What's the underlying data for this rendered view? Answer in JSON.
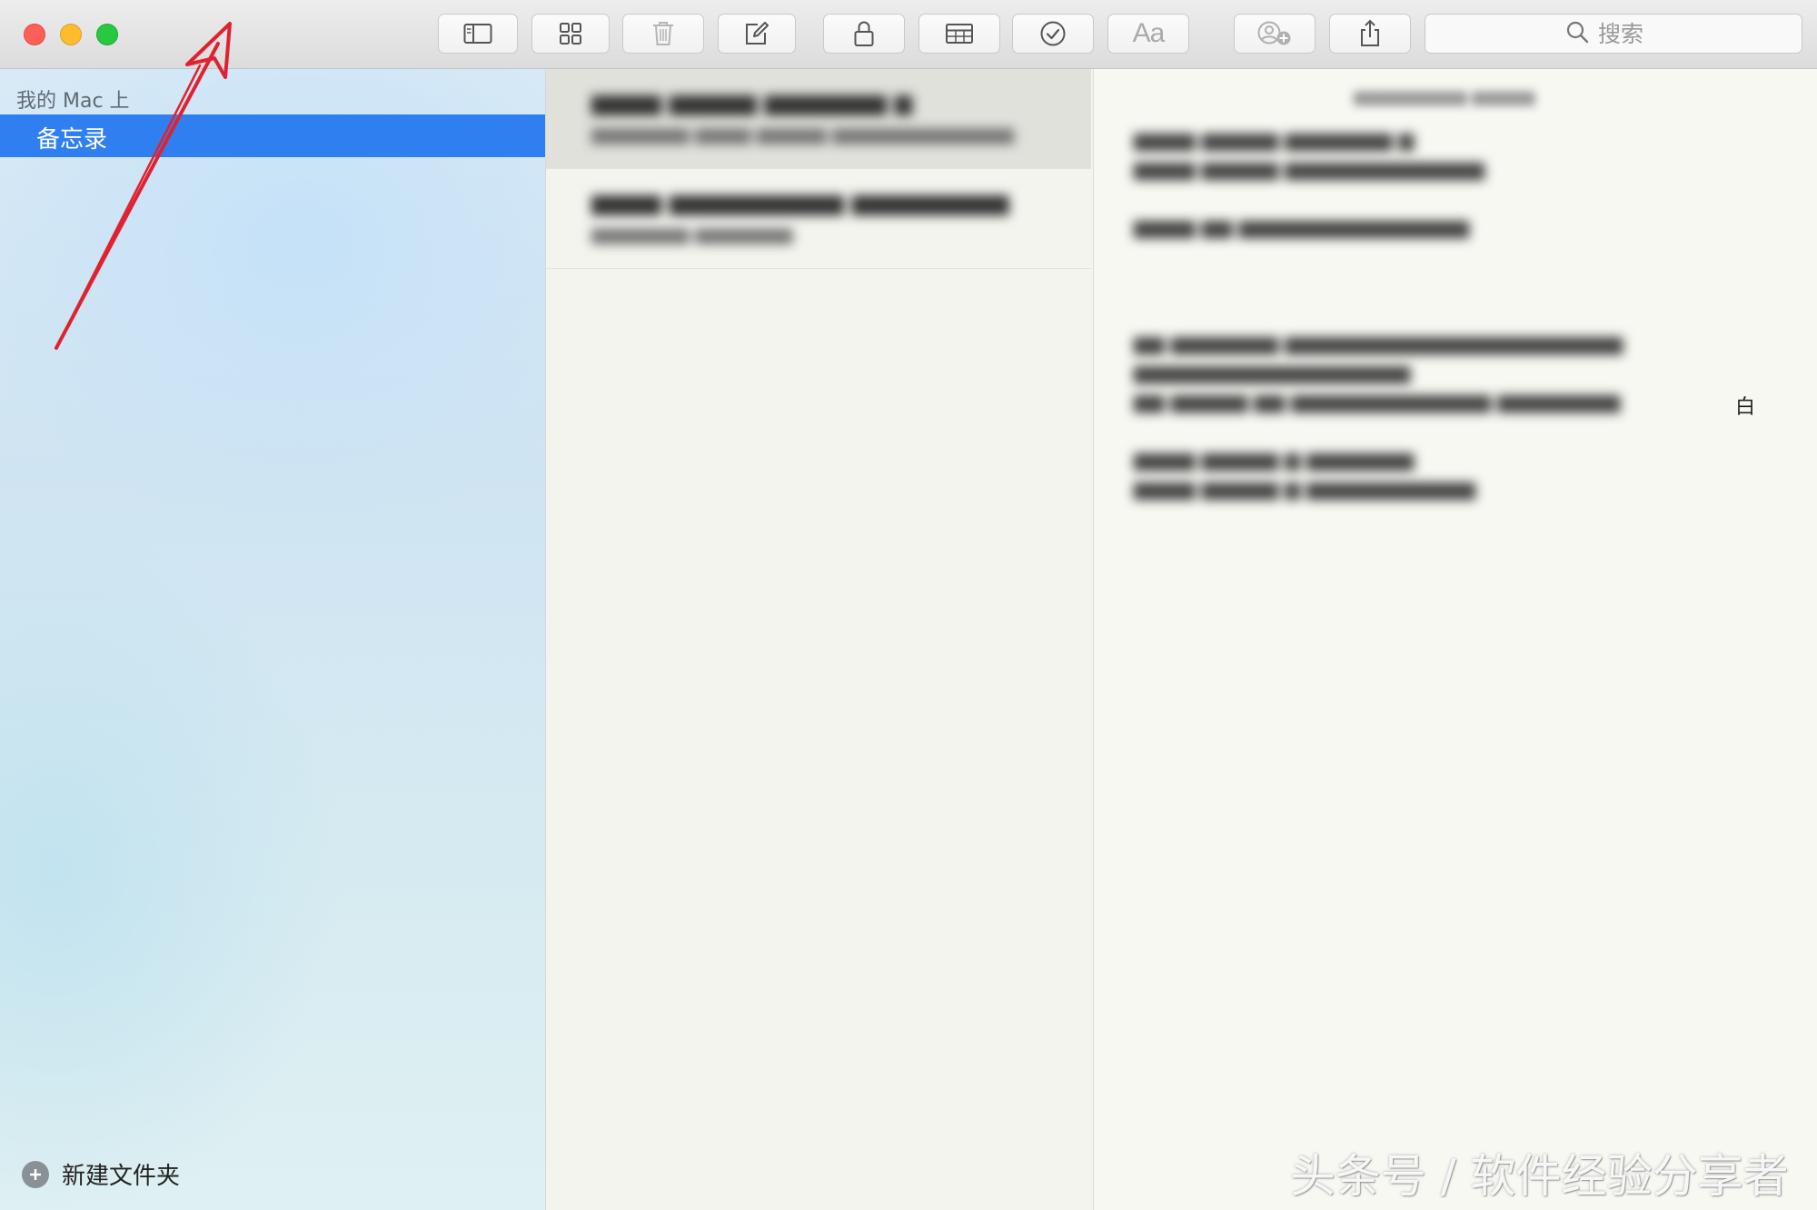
{
  "window": {
    "traffic_lights": [
      "close",
      "minimize",
      "zoom"
    ]
  },
  "toolbar": {
    "buttons": [
      {
        "name": "sidebar-toggle",
        "icon": "sidebar-icon"
      },
      {
        "name": "gallery-view",
        "icon": "grid-icon"
      },
      {
        "name": "delete",
        "icon": "trash-icon"
      },
      {
        "name": "compose",
        "icon": "compose-icon"
      },
      {
        "name": "lock",
        "icon": "lock-icon"
      },
      {
        "name": "table",
        "icon": "table-icon"
      },
      {
        "name": "checklist",
        "icon": "checkmark-circle-icon"
      },
      {
        "name": "format",
        "icon": "text-format-icon",
        "label": "Aa"
      },
      {
        "name": "add-people",
        "icon": "add-person-icon"
      },
      {
        "name": "share",
        "icon": "share-icon"
      }
    ],
    "search_placeholder": "搜索"
  },
  "sidebar": {
    "section_header": "我的 Mac 上",
    "folders": [
      {
        "label": "备忘录",
        "selected": true
      }
    ],
    "new_folder_label": "新建文件夹"
  },
  "editor": {
    "visible_char": "白"
  },
  "colors": {
    "accent": "#2f7ff1",
    "close": "#fc5f57",
    "minimize": "#fdbc2e",
    "zoom": "#28c840",
    "annotation_arrow": "#e02230"
  },
  "watermark": "头条号 / 软件经验分享者"
}
